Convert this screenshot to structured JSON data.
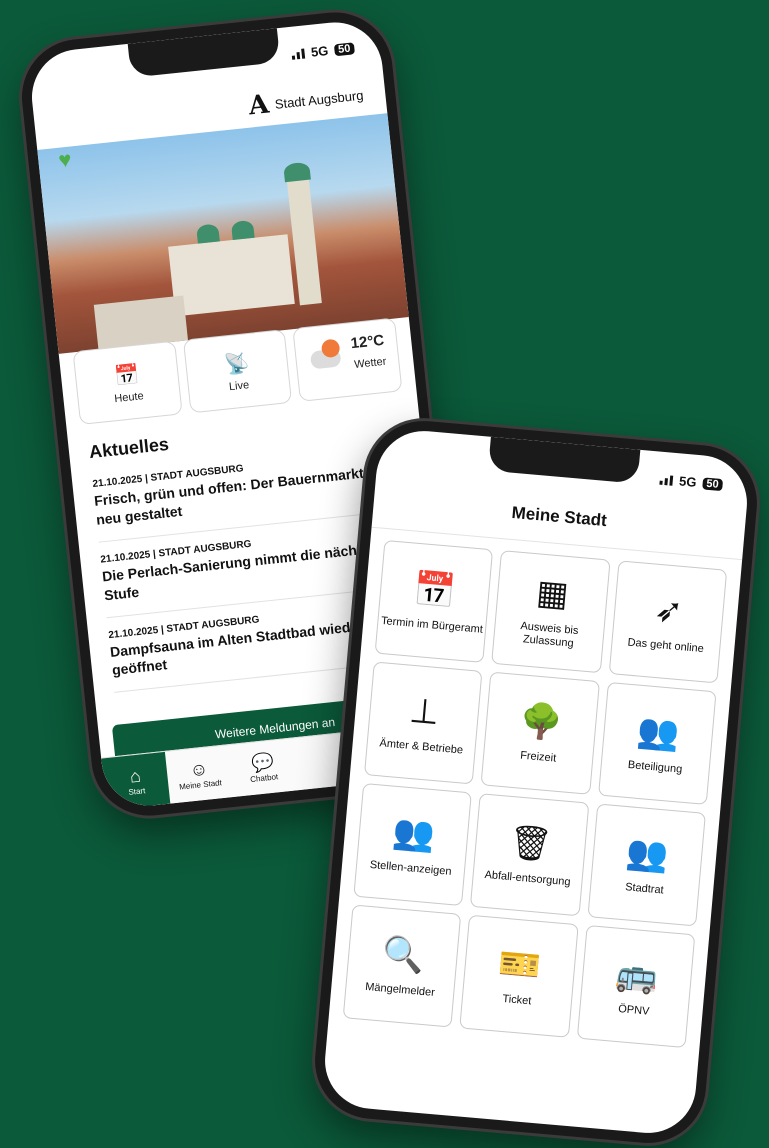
{
  "phone1": {
    "status": {
      "network": "5G",
      "battery": "50"
    },
    "brand": {
      "logo": "A",
      "name": "Stadt Augsburg"
    },
    "favorite_icon": "heart-icon",
    "tiles": [
      {
        "icon": "calendar-star-icon",
        "label": "Heute"
      },
      {
        "icon": "antenna-icon",
        "label": "Live"
      },
      {
        "icon": "weather-icon",
        "temperature": "12°C",
        "label": "Wetter"
      }
    ],
    "news": {
      "heading": "Aktuelles",
      "items": [
        {
          "date_source": "21.10.2025 | STADT AUGSBURG",
          "title": "Frisch, grün und offen: Der Bauernmarkt wird neu gestaltet"
        },
        {
          "date_source": "21.10.2025 | STADT AUGSBURG",
          "title": "Die Perlach-Sanierung nimmt die nächste Stufe"
        },
        {
          "date_source": "21.10.2025 | STADT AUGSBURG",
          "title": "Dampfsauna im Alten Stadtbad wieder geöffnet"
        }
      ],
      "more_button": "Weitere Meldungen an"
    },
    "tabbar": [
      {
        "icon": "home-icon",
        "label": "Start"
      },
      {
        "icon": "smiley-icon",
        "label": "Meine Stadt"
      },
      {
        "icon": "chat-icon",
        "label": "Chatbot"
      }
    ]
  },
  "phone2": {
    "status": {
      "network": "5G",
      "battery": "50"
    },
    "title": "Meine Stadt",
    "grid": [
      {
        "icon": "calendar-icon",
        "label": "Termin im Bürgeramt"
      },
      {
        "icon": "apps-grid-icon",
        "label": "Ausweis bis Zulassung"
      },
      {
        "icon": "cursor-click-icon",
        "label": "Das geht online"
      },
      {
        "icon": "stamp-icon",
        "label": "Ämter & Betriebe"
      },
      {
        "icon": "bench-tree-icon",
        "label": "Freizeit"
      },
      {
        "icon": "people-chat-icon",
        "label": "Beteiligung"
      },
      {
        "icon": "job-people-icon",
        "label": "Stellen-anzeigen"
      },
      {
        "icon": "trash-icon",
        "label": "Abfall-entsorgung"
      },
      {
        "icon": "council-icon",
        "label": "Stadtrat"
      },
      {
        "icon": "magnifier-alert-icon",
        "label": "Mängelmelder"
      },
      {
        "icon": "ticket-icon",
        "label": "Ticket"
      },
      {
        "icon": "bus-icon",
        "label": "ÖPNV"
      }
    ]
  },
  "colors": {
    "background": "#0b5a3a",
    "accent": "#0b5a3a",
    "heart": "#4cae4f"
  }
}
